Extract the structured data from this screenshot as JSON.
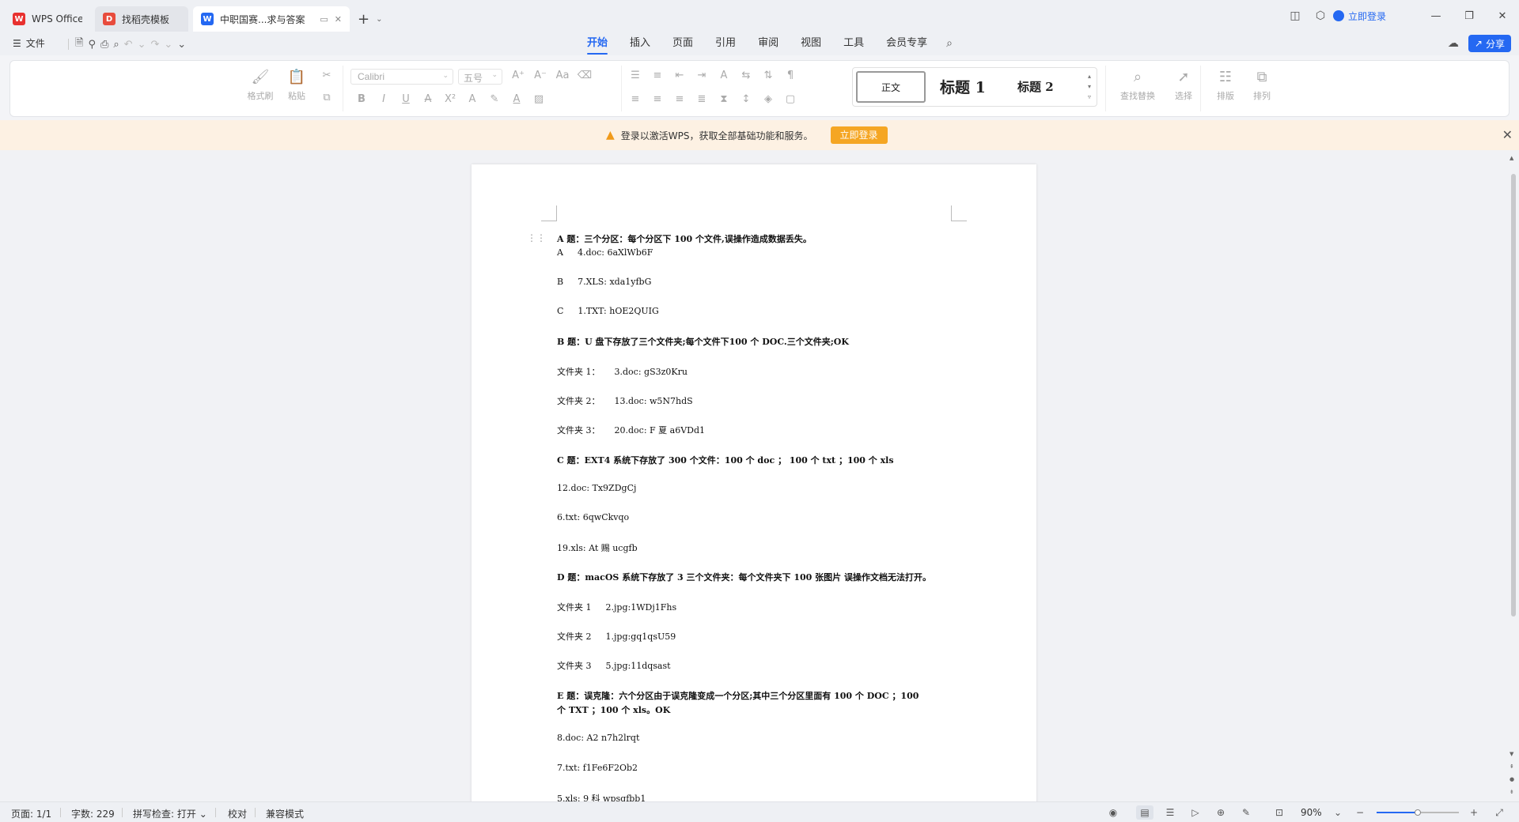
{
  "tabs": {
    "app": "WPS Office",
    "template": "找稻壳模板",
    "document": "中职国赛...求与答案"
  },
  "titlebar": {
    "login": "立即登录"
  },
  "menubar": {
    "file": "文件",
    "items": [
      "开始",
      "插入",
      "页面",
      "引用",
      "审阅",
      "视图",
      "工具",
      "会员专享"
    ],
    "share": "分享"
  },
  "ribbon": {
    "format_painter": "格式刷",
    "paste": "粘贴",
    "font_name": "Calibri",
    "font_size": "五号",
    "style_normal": "正文",
    "style_h1": "标题 1",
    "style_h2": "标题 2",
    "find_replace": "查找替换",
    "select": "选择",
    "layout": "排版",
    "arrange": "排列"
  },
  "notice": {
    "text": "登录以激活WPS，获取全部基础功能和服务。",
    "button": "立即登录"
  },
  "document": {
    "lines": [
      {
        "text": "A 题：三个分区：每个分区下 100 个文件,误操作造成数据丢失。",
        "bold": true
      },
      {
        "c1": "A",
        "c2": "4.doc: 6aXlWb6F"
      },
      {
        "c1": "B",
        "c2": "7.XLS: xda1yfbG"
      },
      {
        "c1": "C",
        "c2": "1.TXT: hOE2QUIG"
      },
      {
        "text": "B 题：U 盘下存放了三个文件夹;每个文件下100 个 DOC.三个文件夹;OK",
        "bold": true
      },
      {
        "c1": "文件夹 1：",
        "c2": "3.doc: gS3z0Kru"
      },
      {
        "c1": "文件夹 2：",
        "c2": "13.doc: w5N7hdS"
      },
      {
        "c1": "文件夹 3：",
        "c2": "20.doc: F 夏 a6VDd1"
      },
      {
        "text": "C 题：EXT4 系统下存放了 300 个文件：100 个 doc  ；  100 个 txt    ；100 个 xls",
        "bold": true
      },
      {
        "text": "12.doc: Tx9ZDgCj"
      },
      {
        "text": "6.txt: 6qwCkvqo"
      },
      {
        "text": "19.xls: At 赐 ucgfb"
      },
      {
        "text": "D 题：macOS 系统下存放了 3 三个文件夹：每个文件夹下 100 张图片  误操作文档无法打开。",
        "bold": true
      },
      {
        "c1": "文件夹 1",
        "c2": "2.jpg:1WDj1Fhs"
      },
      {
        "c1": "文件夹 2",
        "c2": "1.jpg:gq1qsU59"
      },
      {
        "c1": "文件夹 3",
        "c2": "5.jpg:11dqsast"
      },
      {
        "text": "E 题：误克隆：六个分区由于误克隆变成一个分区;其中三个分区里面有 100 个 DOC    ；100",
        "bold": true
      },
      {
        "text": "个 TXT  ；100 个 xls。OK",
        "bold": true
      },
      {
        "text": "8.doc: A2 n7h2lrqt"
      },
      {
        "text": "7.txt: f1Fe6F2Ob2"
      },
      {
        "text": "5.xls: 9 科 wpsgfbb1"
      }
    ]
  },
  "status": {
    "page": "页面: 1/1",
    "words": "字数: 229",
    "spell": "拼写检查: 打开",
    "proof": "校对",
    "compat": "兼容模式",
    "zoom": "90%",
    "zoom_level": 0.5
  },
  "colors": {
    "accent": "#2468f2",
    "notice_bg": "#fdf1e3",
    "notice_button": "#f5a623"
  }
}
